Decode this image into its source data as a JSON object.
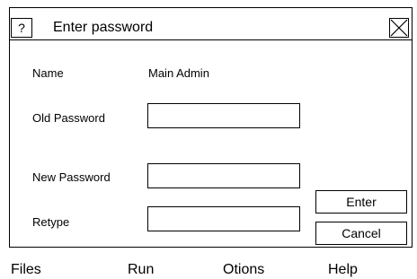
{
  "dialog": {
    "help_label": "?",
    "title": "Enter password",
    "name_label": "Name",
    "name_value": "Main Admin",
    "old_password_label": "Old Password",
    "new_password_label": "New Password",
    "retype_label": "Retype",
    "old_password_value": "",
    "new_password_value": "",
    "retype_value": "",
    "enter_label": "Enter",
    "cancel_label": "Cancel"
  },
  "menu": {
    "items": [
      "Files",
      "Run",
      "Otions",
      "Help"
    ]
  },
  "icons": {
    "help": "help-icon",
    "close": "close-icon"
  },
  "colors": {
    "border": "#000000",
    "background": "#ffffff",
    "text": "#000000"
  }
}
